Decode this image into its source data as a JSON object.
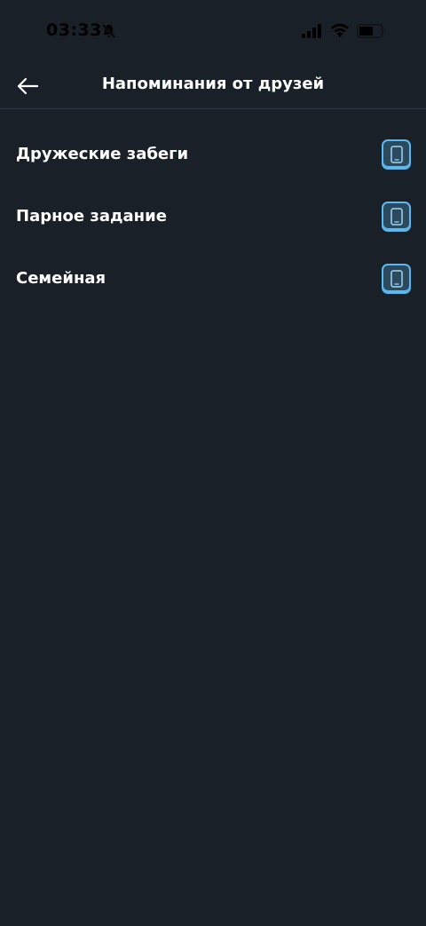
{
  "status_bar": {
    "time": "03:33",
    "icons": [
      "bell-off-icon",
      "cellular-signal-icon",
      "wifi-icon",
      "battery-icon"
    ]
  },
  "header": {
    "back_icon": "arrow-left-icon",
    "title": "Напоминания от друзей"
  },
  "colors": {
    "background": "#1a2027",
    "text": "#ffffff",
    "accent": "#5ab9f0",
    "divider": "#2f3a44"
  },
  "reminders": {
    "items": [
      {
        "label": "Дружеские забеги",
        "icon": "phone-icon"
      },
      {
        "label": "Парное задание",
        "icon": "phone-icon"
      },
      {
        "label": "Семейная",
        "icon": "phone-icon"
      }
    ]
  }
}
